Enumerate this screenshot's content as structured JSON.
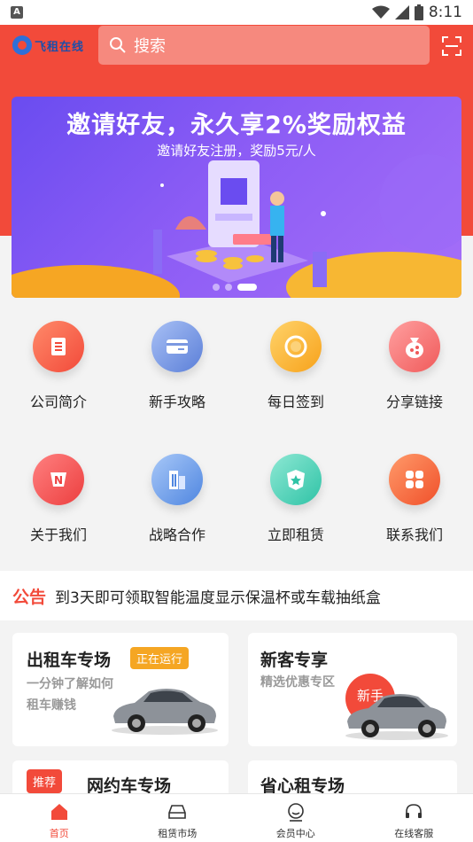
{
  "status": {
    "time": "8:11",
    "a_label": "A"
  },
  "header": {
    "logo_text": "飞租在线",
    "search_placeholder": "搜索"
  },
  "banner": {
    "title": "邀请好友，永久享2%奖励权益",
    "subtitle": "邀请好友注册，奖励5元/人"
  },
  "menu": [
    {
      "label": "公司简介",
      "icon": "document-icon"
    },
    {
      "label": "新手攻略",
      "icon": "card-icon"
    },
    {
      "label": "每日签到",
      "icon": "refresh-icon"
    },
    {
      "label": "分享链接",
      "icon": "share-bag-icon"
    },
    {
      "label": "关于我们",
      "icon": "n-badge-icon"
    },
    {
      "label": "战略合作",
      "icon": "building-icon"
    },
    {
      "label": "立即租赁",
      "icon": "shield-star-icon"
    },
    {
      "label": "联系我们",
      "icon": "grid-icon"
    }
  ],
  "notice": {
    "tag": "公告",
    "text": "到3天即可领取智能温度显示保温杯或车载抽纸盒"
  },
  "cards": {
    "taxi": {
      "title": "出租车专场",
      "badge": "正在运行",
      "desc_line1": "一分钟了解如何",
      "desc_line2": "租车赚钱"
    },
    "newcomer": {
      "title": "新客专享",
      "desc": "精选优惠专区",
      "bubble": "新手"
    },
    "ride": {
      "title": "网约车专场",
      "tag": "推荐"
    },
    "save": {
      "title": "省心租专场"
    }
  },
  "tabs": [
    {
      "label": "首页",
      "icon": "home-icon",
      "active": true
    },
    {
      "label": "租赁市场",
      "icon": "car-icon",
      "active": false
    },
    {
      "label": "会员中心",
      "icon": "user-icon",
      "active": false
    },
    {
      "label": "在线客服",
      "icon": "headset-icon",
      "active": false
    }
  ],
  "colors": {
    "brand_red": "#f24a3a",
    "badge_orange": "#f5a623",
    "banner_purple": "#7b55f3"
  }
}
